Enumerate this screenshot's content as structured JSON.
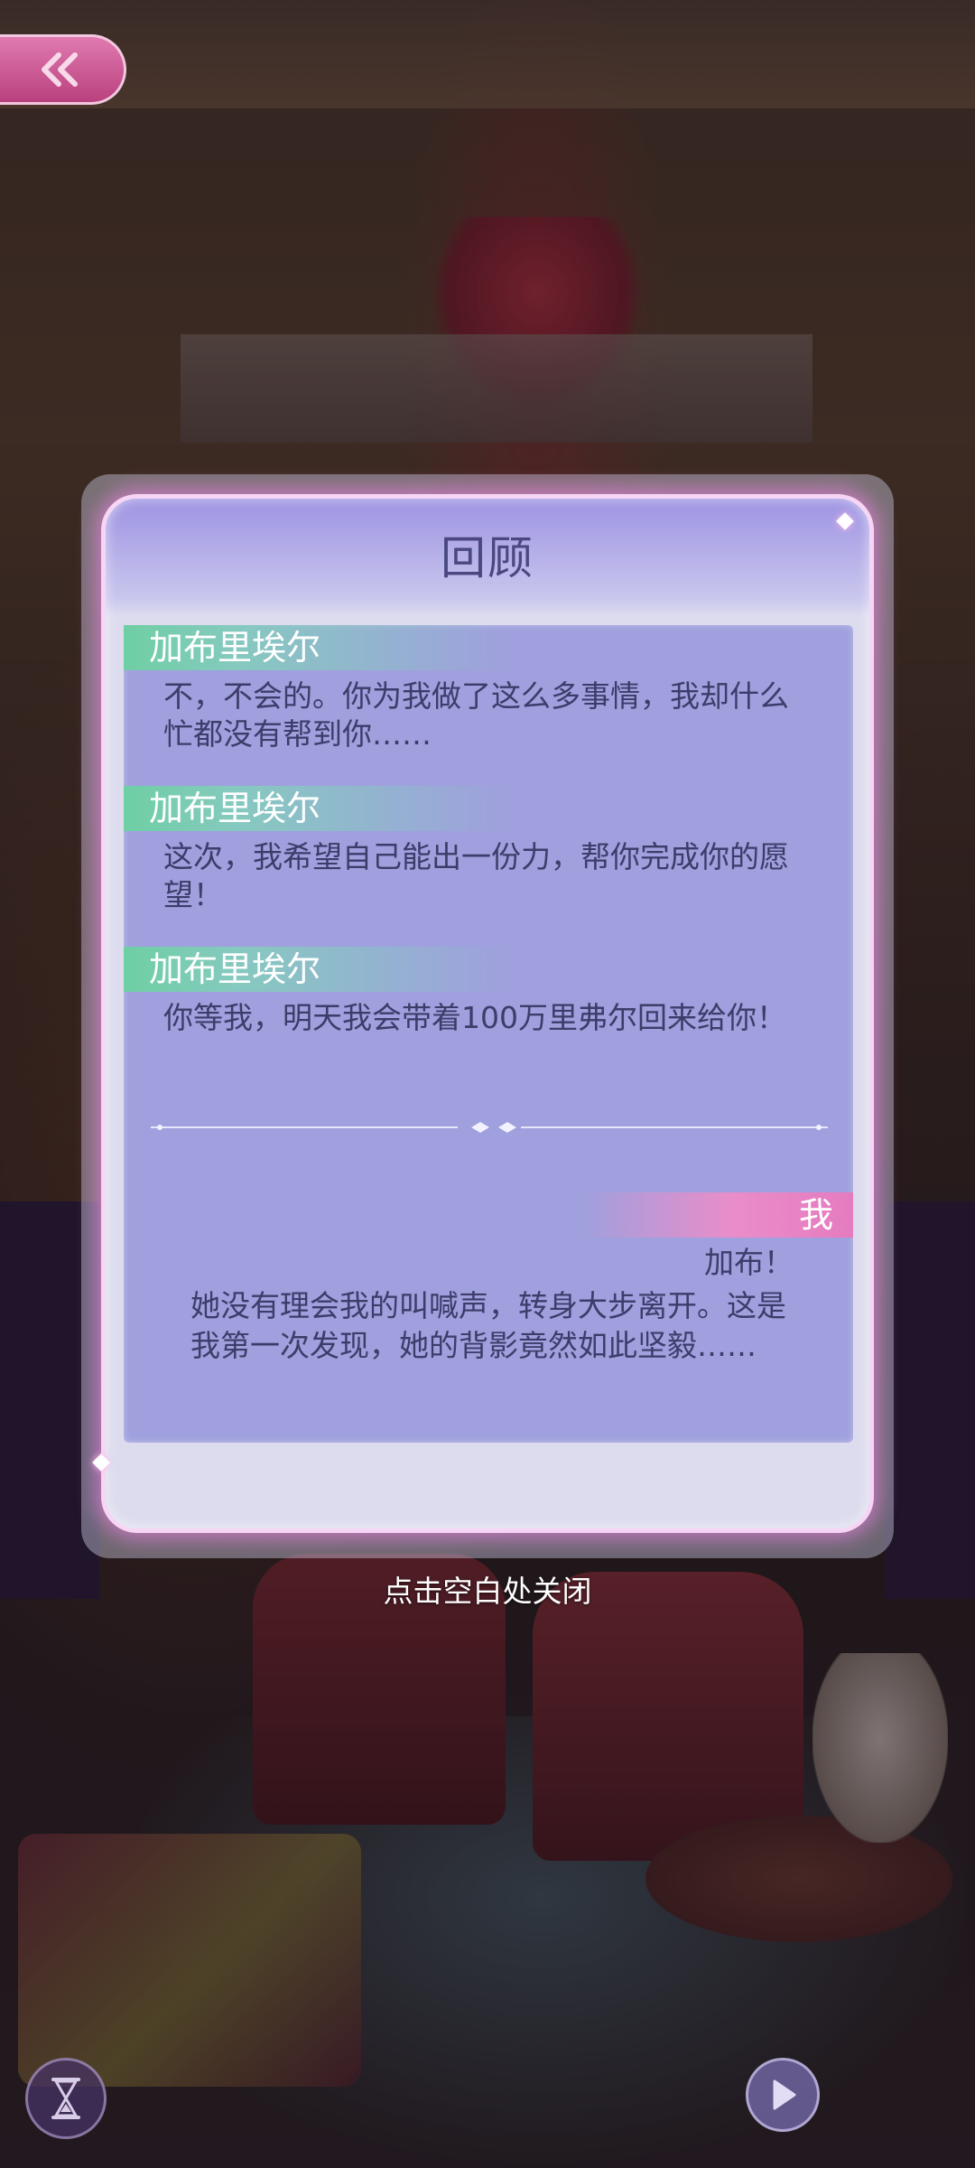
{
  "header": {
    "back_icon": "double-chevron-left-icon"
  },
  "panel": {
    "title": "回顾"
  },
  "log": {
    "entries": [
      {
        "speaker": "加布里埃尔",
        "text": "不，不会的。你为我做了这么多事情，我却什么忙都没有帮到你……"
      },
      {
        "speaker": "加布里埃尔",
        "text": "这次，我希望自己能出一份力，帮你完成你的愿望！"
      },
      {
        "speaker": "加布里埃尔",
        "text": "你等我，明天我会带着100万里弗尔回来给你！"
      }
    ],
    "player": {
      "speaker": "我",
      "text": "加布！"
    },
    "narration": "她没有理会我的叫喊声，转身大步离开。这是我第一次发现，她的背影竟然如此坚毅……"
  },
  "footer": {
    "close_hint": "点击空白处关闭",
    "left_icon": "hourglass-icon",
    "right_icon": "play-icon"
  },
  "colors": {
    "speaker_tag": "#6ecfa3",
    "player_tag": "#e67bc0",
    "panel_glow": "#f082e6",
    "log_background": "#9fa0dd",
    "title_text": "#4a4880"
  }
}
